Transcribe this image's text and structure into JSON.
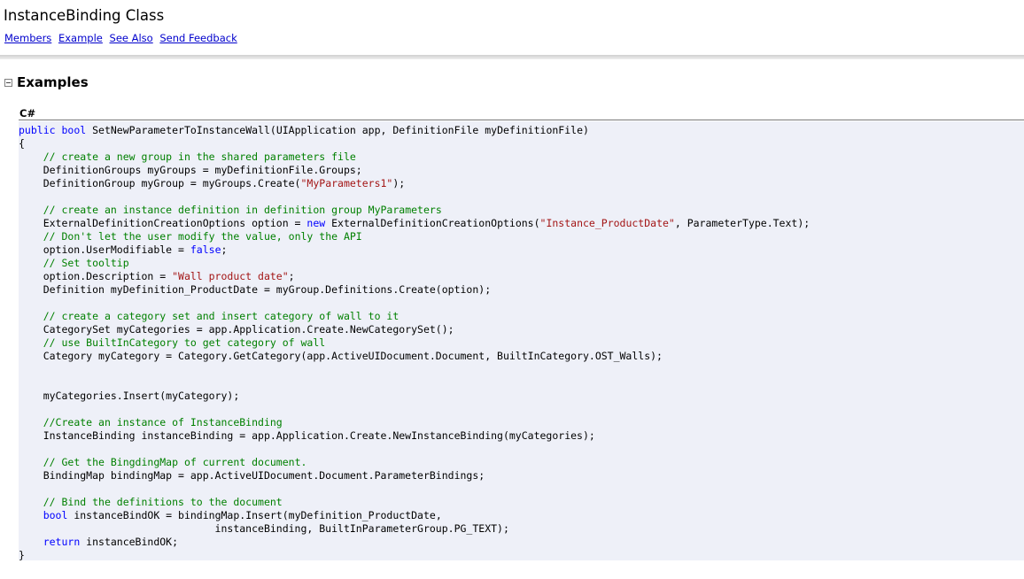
{
  "header": {
    "title": "InstanceBinding Class",
    "nav_links": [
      "Members",
      "Example",
      "See Also",
      "Send Feedback"
    ]
  },
  "section": {
    "title": "Examples",
    "language": "C#"
  },
  "code_lines": [
    [
      [
        "kw",
        "public"
      ],
      [
        "t",
        " "
      ],
      [
        "kw",
        "bool"
      ],
      [
        "t",
        " SetNewParameterToInstanceWall(UIApplication app, DefinitionFile myDefinitionFile)"
      ]
    ],
    [
      [
        "t",
        "{"
      ]
    ],
    [
      [
        "t",
        "    "
      ],
      [
        "cm",
        "// create a new group in the shared parameters file"
      ]
    ],
    [
      [
        "t",
        "    DefinitionGroups myGroups = myDefinitionFile.Groups;"
      ]
    ],
    [
      [
        "t",
        "    DefinitionGroup myGroup = myGroups.Create("
      ],
      [
        "st",
        "\"MyParameters1\""
      ],
      [
        "t",
        ");"
      ]
    ],
    [],
    [
      [
        "t",
        "    "
      ],
      [
        "cm",
        "// create an instance definition in definition group MyParameters"
      ]
    ],
    [
      [
        "t",
        "    ExternalDefinitionCreationOptions option = "
      ],
      [
        "kw",
        "new"
      ],
      [
        "t",
        " ExternalDefinitionCreationOptions("
      ],
      [
        "st",
        "\"Instance_ProductDate\""
      ],
      [
        "t",
        ", ParameterType.Text);"
      ]
    ],
    [
      [
        "t",
        "    "
      ],
      [
        "cm",
        "// Don't let the user modify the value, only the API"
      ]
    ],
    [
      [
        "t",
        "    option.UserModifiable = "
      ],
      [
        "kw",
        "false"
      ],
      [
        "t",
        ";"
      ]
    ],
    [
      [
        "t",
        "    "
      ],
      [
        "cm",
        "// Set tooltip"
      ]
    ],
    [
      [
        "t",
        "    option.Description = "
      ],
      [
        "st",
        "\"Wall product date\""
      ],
      [
        "t",
        ";"
      ]
    ],
    [
      [
        "t",
        "    Definition myDefinition_ProductDate = myGroup.Definitions.Create(option);"
      ]
    ],
    [],
    [
      [
        "t",
        "    "
      ],
      [
        "cm",
        "// create a category set and insert category of wall to it"
      ]
    ],
    [
      [
        "t",
        "    CategorySet myCategories = app.Application.Create.NewCategorySet();"
      ]
    ],
    [
      [
        "t",
        "    "
      ],
      [
        "cm",
        "// use BuiltInCategory to get category of wall"
      ]
    ],
    [
      [
        "t",
        "    Category myCategory = Category.GetCategory(app.ActiveUIDocument.Document, BuiltInCategory.OST_Walls);"
      ]
    ],
    [],
    [],
    [
      [
        "t",
        "    myCategories.Insert(myCategory);"
      ]
    ],
    [],
    [
      [
        "t",
        "    "
      ],
      [
        "cm",
        "//Create an instance of InstanceBinding"
      ]
    ],
    [
      [
        "t",
        "    InstanceBinding instanceBinding = app.Application.Create.NewInstanceBinding(myCategories);"
      ]
    ],
    [],
    [
      [
        "t",
        "    "
      ],
      [
        "cm",
        "// Get the BingdingMap of current document."
      ]
    ],
    [
      [
        "t",
        "    BindingMap bindingMap = app.ActiveUIDocument.Document.ParameterBindings;"
      ]
    ],
    [],
    [
      [
        "t",
        "    "
      ],
      [
        "cm",
        "// Bind the definitions to the document"
      ]
    ],
    [
      [
        "t",
        "    "
      ],
      [
        "kw",
        "bool"
      ],
      [
        "t",
        " instanceBindOK = bindingMap.Insert(myDefinition_ProductDate,"
      ]
    ],
    [
      [
        "t",
        "                                instanceBinding, BuiltInParameterGroup.PG_TEXT);"
      ]
    ],
    [
      [
        "t",
        "    "
      ],
      [
        "kw",
        "return"
      ],
      [
        "t",
        " instanceBindOK;"
      ]
    ],
    [
      [
        "t",
        "}"
      ]
    ]
  ],
  "colors": {
    "keyword": "#0000ff",
    "comment": "#008000",
    "string": "#a31515",
    "link": "#0000cc",
    "code_background": "#eef0f8"
  }
}
